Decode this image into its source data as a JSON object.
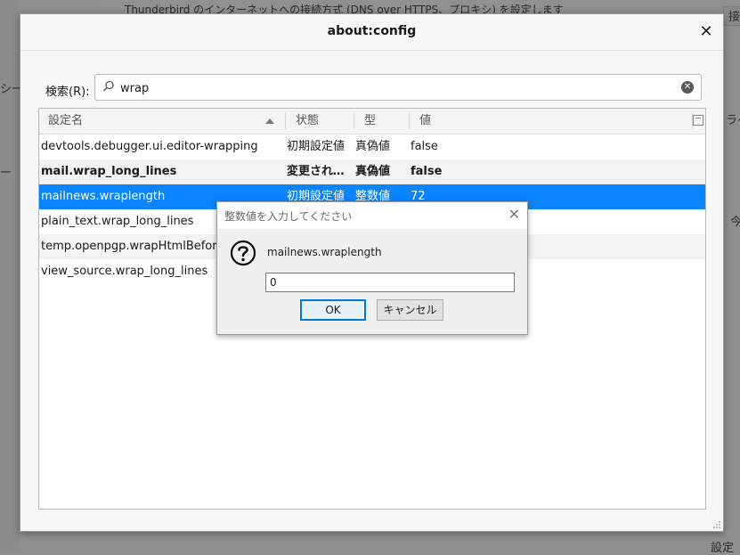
{
  "window": {
    "title": "about:config"
  },
  "background": {
    "top_text": "Thunderbird のインターネットへの接続方式 (DNS over HTTPS、プロキシ) を設定します",
    "left_texts": [
      "シー",
      "ー"
    ],
    "right_texts": [
      "接",
      "ライ",
      "今",
      "設定"
    ]
  },
  "search": {
    "label": "検索(R):",
    "value": "wrap"
  },
  "columns": {
    "name": "設定名",
    "status": "状態",
    "type": "型",
    "value": "値"
  },
  "rows": [
    {
      "name": "devtools.debugger.ui.editor-wrapping",
      "status": "初期設定値",
      "type": "真偽値",
      "value": "false"
    },
    {
      "name": "mail.wrap_long_lines",
      "status": "変更されています",
      "type": "真偽値",
      "value": "false"
    },
    {
      "name": "mailnews.wraplength",
      "status": "初期設定値",
      "type": "整数値",
      "value": "72"
    },
    {
      "name": "plain_text.wrap_long_lines",
      "status": "",
      "type": "",
      "value": ""
    },
    {
      "name": "temp.openpgp.wrapHtmlBeforeSend",
      "status": "",
      "type": "",
      "value": ""
    },
    {
      "name": "view_source.wrap_long_lines",
      "status": "",
      "type": "",
      "value": ""
    }
  ],
  "dialog": {
    "title": "整数値を入力してください",
    "message": "mailnews.wraplength",
    "input_value": "0",
    "ok_label": "OK",
    "cancel_label": "キャンセル"
  },
  "colors": {
    "selection": "#0a84ff",
    "ok_border": "#0078d7"
  }
}
